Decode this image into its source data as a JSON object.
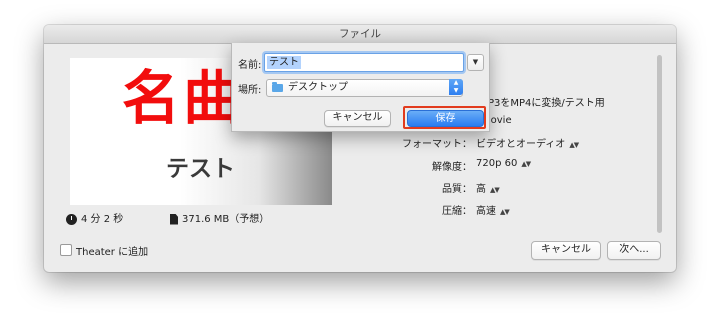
{
  "window": {
    "title": "ファイル"
  },
  "preview": {
    "big_text": "名曲",
    "small_text": "テスト"
  },
  "info": {
    "duration": "4 分 2 秒",
    "size": "371.6 MB（予想）"
  },
  "partial": {
    "line1": "P3をMP4に変換/テスト用",
    "line2": "Movie"
  },
  "settings": {
    "format_label": "フォーマット：",
    "format_value": "ビデオとオーディオ",
    "resolution_label": "解像度：",
    "resolution_value": "720p 60",
    "quality_label": "品質：",
    "quality_value": "高",
    "compression_label": "圧縮：",
    "compression_value": "高速"
  },
  "checkbox": {
    "label": "Theater に追加"
  },
  "buttons": {
    "cancel": "キャンセル",
    "next": "次へ..."
  },
  "sheet": {
    "name_label": "名前:",
    "name_value": "テスト",
    "location_label": "場所:",
    "location_value": "デスクトップ",
    "cancel": "キャンセル",
    "save": "保存"
  },
  "colors": {
    "accent": "#2a7cf1",
    "highlight": "#e23b1e",
    "preview_text": "#f20d0d"
  }
}
